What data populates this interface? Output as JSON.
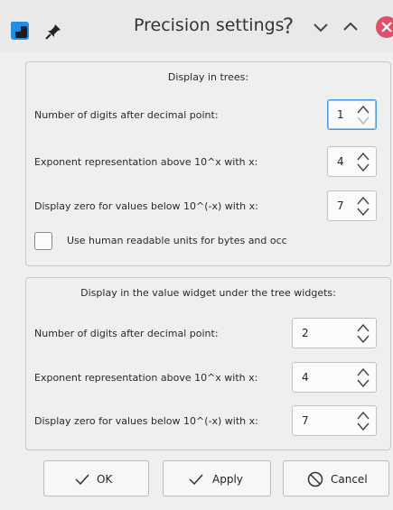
{
  "window": {
    "title": "Precision settings",
    "help_label": "?"
  },
  "trees_group": {
    "title": "Display in trees:",
    "rows": [
      {
        "label": "Number of digits after decimal point:",
        "value": "1"
      },
      {
        "label": "Exponent representation above 10^x with x:",
        "value": "4"
      },
      {
        "label": "Display zero for values below 10^(-x) with x:",
        "value": "7"
      }
    ],
    "checkbox_label": "Use human readable units for bytes and occ",
    "checkbox_checked": false
  },
  "value_widget_group": {
    "title": "Display in the value widget under the tree widgets:",
    "rows": [
      {
        "label": "Number of digits after decimal point:",
        "value": "2"
      },
      {
        "label": "Exponent representation above 10^x with x:",
        "value": "4"
      },
      {
        "label": "Display zero for values below 10^(-x) with x:",
        "value": "7"
      }
    ]
  },
  "buttons": {
    "ok": "OK",
    "apply": "Apply",
    "cancel": "Cancel"
  },
  "colors": {
    "accent": "#4a9be0",
    "close_button": "#e0506a",
    "app_icon_blue": "#1f8fe5"
  },
  "icons": [
    "app-icon",
    "pin-icon",
    "help-icon",
    "chevron-down-icon",
    "chevron-up-icon",
    "close-icon",
    "checkmark-icon",
    "cancel-icon"
  ]
}
